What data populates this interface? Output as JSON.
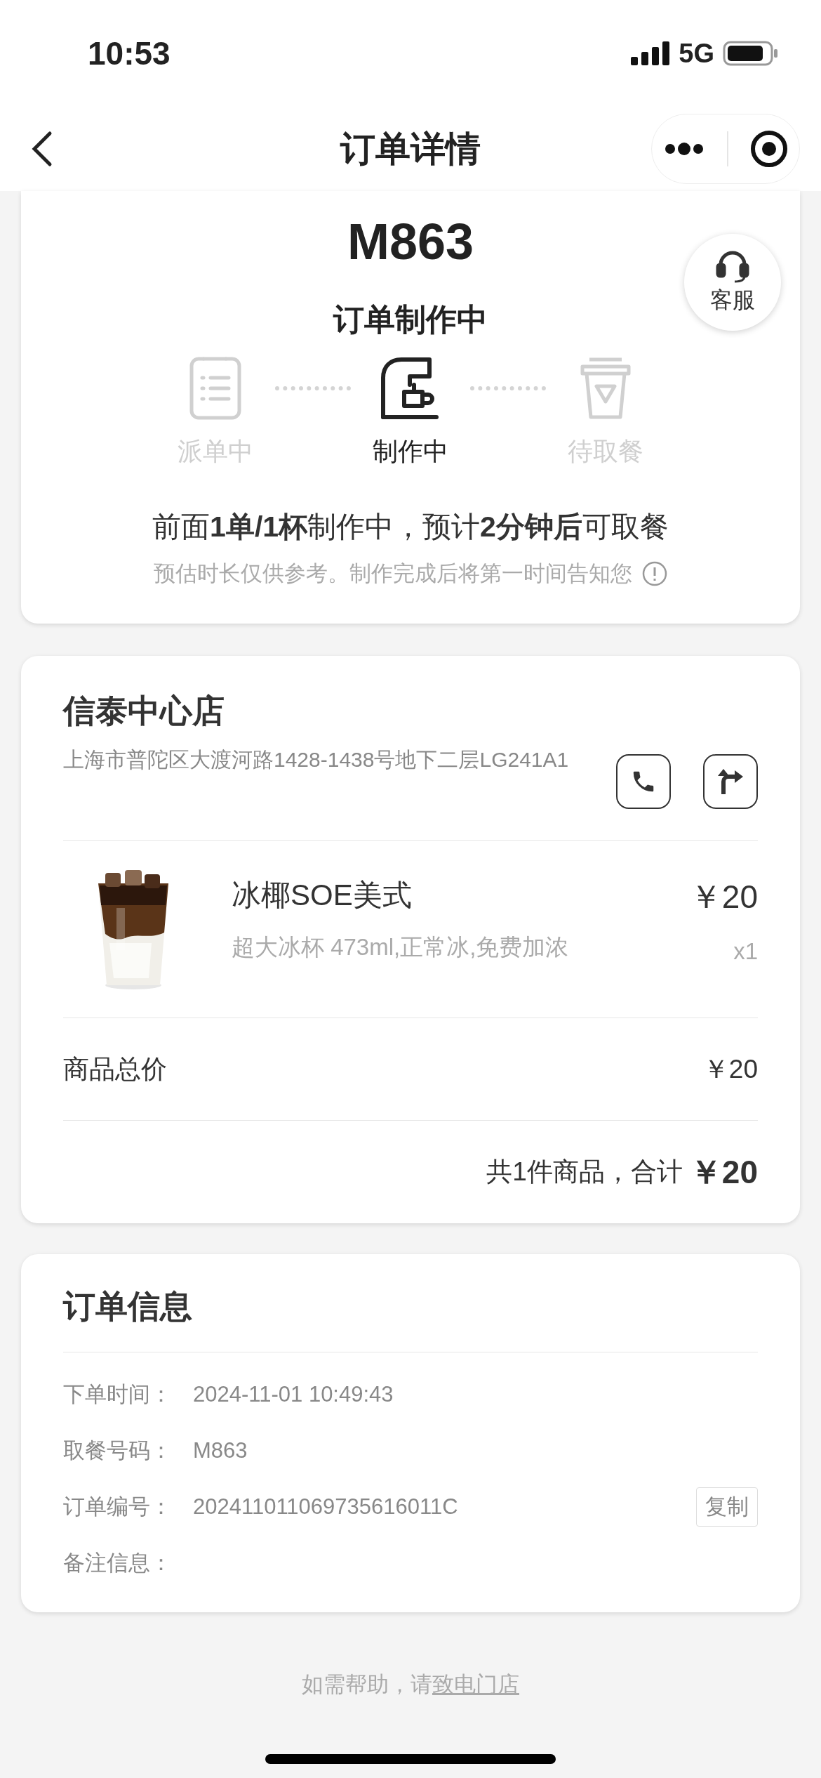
{
  "status_bar": {
    "time": "10:53",
    "network": "5G"
  },
  "nav": {
    "title": "订单详情"
  },
  "order_status": {
    "pickup_code": "M863",
    "title": "订单制作中",
    "steps": [
      {
        "label": "派单中",
        "active": false,
        "kind": "list"
      },
      {
        "label": "制作中",
        "active": true,
        "kind": "machine"
      },
      {
        "label": "待取餐",
        "active": false,
        "kind": "cup"
      }
    ],
    "notice": "前面**1单/1杯**制作中，预计**2分钟后**可取餐",
    "hint": "预估时长仅供参考。制作完成后将第一时间告知您"
  },
  "service_button": {
    "label": "客服"
  },
  "store": {
    "name": "信泰中心店",
    "address": "上海市普陀区大渡河路1428-1438号地下二层LG241A1",
    "item": {
      "name": "冰椰SOE美式",
      "options": "超大冰杯 473ml,正常冰,免费加浓",
      "price": "￥20",
      "quantity": "x1",
      "kind": "picture"
    },
    "subtotal_label": "商品总价",
    "subtotal": "￥20",
    "summary": "共1件商品，合计",
    "total": "￥20"
  },
  "order_info": {
    "title": "订单信息",
    "rows": [
      {
        "label": "下单时间：",
        "value": "2024-11-01 10:49:43"
      },
      {
        "label": "取餐号码：",
        "value": "M863"
      },
      {
        "label": "订单编号：",
        "value": "202411011069735616011C",
        "action": "复制"
      },
      {
        "label": "备注信息："
      }
    ]
  },
  "footer": {
    "text": "如需帮助，请",
    "link": "致电门店"
  }
}
